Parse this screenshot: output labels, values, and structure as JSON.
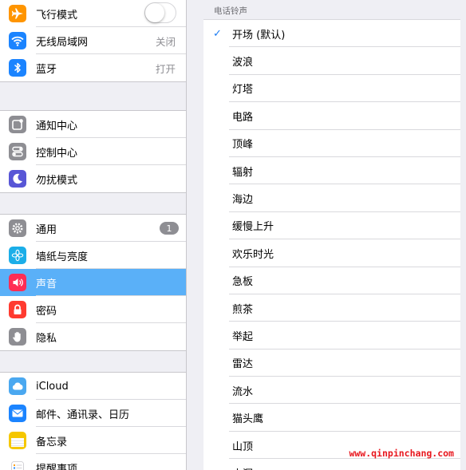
{
  "sidebar": {
    "group1": [
      {
        "name": "airplane-mode",
        "label": "飞行模式",
        "icon": "airplane-icon",
        "color": "#ff9500",
        "accessory": "toggle"
      },
      {
        "name": "wifi",
        "label": "无线局域网",
        "icon": "wifi-icon",
        "color": "#1b84ff",
        "value": "关闭"
      },
      {
        "name": "bluetooth",
        "label": "蓝牙",
        "icon": "bluetooth-icon",
        "color": "#1b84ff",
        "value": "打开"
      }
    ],
    "group2": [
      {
        "name": "notification-center",
        "label": "通知中心",
        "icon": "notification-icon",
        "color": "#8e8e93"
      },
      {
        "name": "control-center",
        "label": "控制中心",
        "icon": "control-center-icon",
        "color": "#8e8e93"
      },
      {
        "name": "do-not-disturb",
        "label": "勿扰模式",
        "icon": "moon-icon",
        "color": "#5856d6"
      }
    ],
    "group3": [
      {
        "name": "general",
        "label": "通用",
        "icon": "gear-icon",
        "color": "#8e8e93",
        "badge": "1"
      },
      {
        "name": "wallpaper",
        "label": "墙纸与亮度",
        "icon": "flower-icon",
        "color": "#1baee8"
      },
      {
        "name": "sounds",
        "label": "声音",
        "icon": "speaker-icon",
        "color": "#ff2d55",
        "selected": true
      },
      {
        "name": "passcode",
        "label": "密码",
        "icon": "lock-icon",
        "color": "#ff3b30"
      },
      {
        "name": "privacy",
        "label": "隐私",
        "icon": "hand-icon",
        "color": "#8e8e93"
      }
    ],
    "group4": [
      {
        "name": "icloud",
        "label": "iCloud",
        "icon": "cloud-icon",
        "color": "#4aa8f0"
      },
      {
        "name": "mail",
        "label": "邮件、通讯录、日历",
        "icon": "mail-icon",
        "color": "#1b84ff"
      },
      {
        "name": "notes",
        "label": "备忘录",
        "icon": "notes-icon",
        "color": "#f5c700"
      },
      {
        "name": "reminders",
        "label": "提醒事项",
        "icon": "reminders-icon",
        "color": "#ffffff"
      }
    ]
  },
  "detail": {
    "section_header": "电话铃声",
    "check_glyph": "✓",
    "tones": [
      {
        "label": "开场 (默认)",
        "checked": true
      },
      {
        "label": "波浪"
      },
      {
        "label": "灯塔"
      },
      {
        "label": "电路"
      },
      {
        "label": "顶峰"
      },
      {
        "label": "辐射"
      },
      {
        "label": "海边"
      },
      {
        "label": "缓慢上升"
      },
      {
        "label": "欢乐时光"
      },
      {
        "label": "急板"
      },
      {
        "label": "煎茶"
      },
      {
        "label": "举起"
      },
      {
        "label": "雷达"
      },
      {
        "label": "流水"
      },
      {
        "label": "猫头鹰"
      },
      {
        "label": "山顶"
      },
      {
        "label": "山洞"
      }
    ]
  },
  "watermark": "www.qinpinchang.com"
}
